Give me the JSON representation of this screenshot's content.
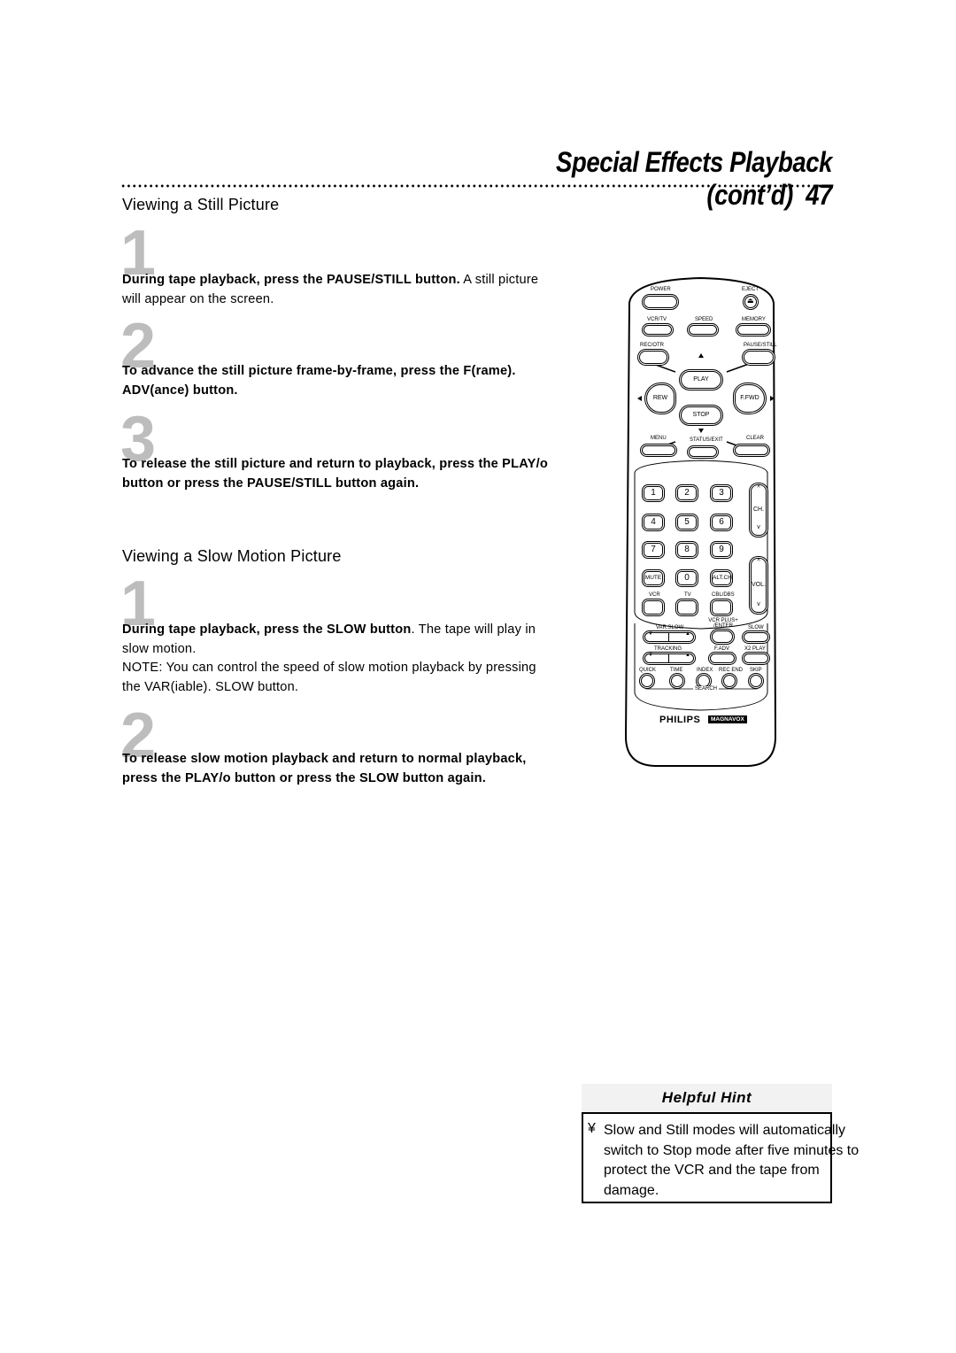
{
  "header": {
    "title": "Special Effects Playback (cont’d)",
    "page_number": "47"
  },
  "still_section": {
    "heading": "Viewing a Still Picture",
    "steps": [
      {
        "number": "1",
        "bold": "During tape playback, press the PAUSE/STILL button.",
        "normal": " A still picture will appear on the screen."
      },
      {
        "number": "2",
        "bold": "To advance the still picture frame-by-frame, press the F(rame). ADV(ance) button.",
        "normal": ""
      },
      {
        "number": "3",
        "bold": "To release the still picture and return to playback, press the PLAY/o  button or press the PAUSE/STILL button again.",
        "normal": ""
      }
    ]
  },
  "slow_section": {
    "heading": "Viewing a Slow Motion Picture",
    "steps": [
      {
        "number": "1",
        "bold": "During tape playback, press the SLOW  button",
        "normal": ".  The tape will play in slow motion.",
        "note": "NOTE: You can control the speed of slow motion playback by pressing the VAR(iable). SLOW button."
      },
      {
        "number": "2",
        "bold": "To release slow motion playback and return to normal playback, press the PLAY/o  button or press the SLOW button again.",
        "normal": ""
      }
    ]
  },
  "remote": {
    "labels": {
      "power": "POWER",
      "eject": "EJECT",
      "vcr_tv": "VCR/TV",
      "speed": "SPEED",
      "memory": "MEMORY",
      "rec_otr": "REC/OTR",
      "pause_still": "PAUSE/STILL",
      "play": "PLAY",
      "rew": "REW",
      "ffwd": "F.FWD",
      "stop": "STOP",
      "menu": "MENU",
      "status_exit": "STATUS/EXIT",
      "clear": "CLEAR",
      "ch": "CH.",
      "vol": "VOL.",
      "mute": "MUTE",
      "alt_ch": "ALT.CH",
      "vcr": "VCR",
      "tv": "TV",
      "cbl_dbs": "CBL/DBS",
      "vcr_plus": "VCR PLUS+ /ENTER",
      "var_slow": "VAR.SLOW",
      "slow": "SLOW",
      "tracking": "TRACKING",
      "f_adv": "F.ADV",
      "x2_play": "X2 PLAY",
      "quick": "QUICK",
      "time": "TIME",
      "index": "INDEX",
      "rec_end": "REC END",
      "skip": "SKIP",
      "search": "SEARCH",
      "brand1": "PHILIPS",
      "brand2": "MAGNAVOX"
    },
    "digits": [
      "1",
      "2",
      "3",
      "4",
      "5",
      "6",
      "7",
      "8",
      "9",
      "0"
    ]
  },
  "hint": {
    "title": "Helpful Hint",
    "bullet": "¥",
    "text": "Slow and Still modes will automatically switch to Stop mode after five minutes to protect the VCR and the tape from damage."
  }
}
